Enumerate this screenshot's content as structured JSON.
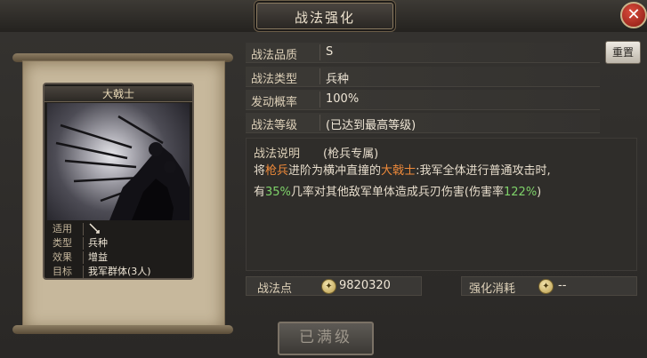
{
  "header": {
    "title": "战法强化",
    "close_label": "✕"
  },
  "card": {
    "name": "大戟士",
    "info": [
      {
        "key": "适用",
        "value": ""
      },
      {
        "key": "类型",
        "value": "兵种"
      },
      {
        "key": "效果",
        "value": "增益"
      },
      {
        "key": "目标",
        "value": "我军群体(3人)"
      }
    ]
  },
  "attributes": [
    {
      "label": "战法品质",
      "value": "S"
    },
    {
      "label": "战法类型",
      "value": "兵种"
    },
    {
      "label": "发动概率",
      "value": "100%"
    },
    {
      "label": "战法等级",
      "value": "(已达到最高等级)"
    }
  ],
  "reset_label": "重置",
  "description": {
    "title": "战法说明",
    "subtitle": "(枪兵专属)",
    "line1": [
      {
        "text": "将",
        "hl": ""
      },
      {
        "text": "枪兵",
        "hl": "orange"
      },
      {
        "text": "进阶为横冲直撞的",
        "hl": ""
      },
      {
        "text": "大戟士",
        "hl": "orange"
      },
      {
        "text": ":我军全体进行普通攻击时,",
        "hl": ""
      }
    ],
    "line2": [
      {
        "text": "有",
        "hl": ""
      },
      {
        "text": "35%",
        "hl": "green"
      },
      {
        "text": "几率对其他敌军单体造成兵刃伤害(伤害率",
        "hl": ""
      },
      {
        "text": "122%",
        "hl": "green"
      },
      {
        "text": ")",
        "hl": ""
      }
    ]
  },
  "points": {
    "label": "战法点",
    "value": "9820320"
  },
  "cost": {
    "label": "强化消耗",
    "value": "--"
  },
  "max_button_label": "已满级"
}
